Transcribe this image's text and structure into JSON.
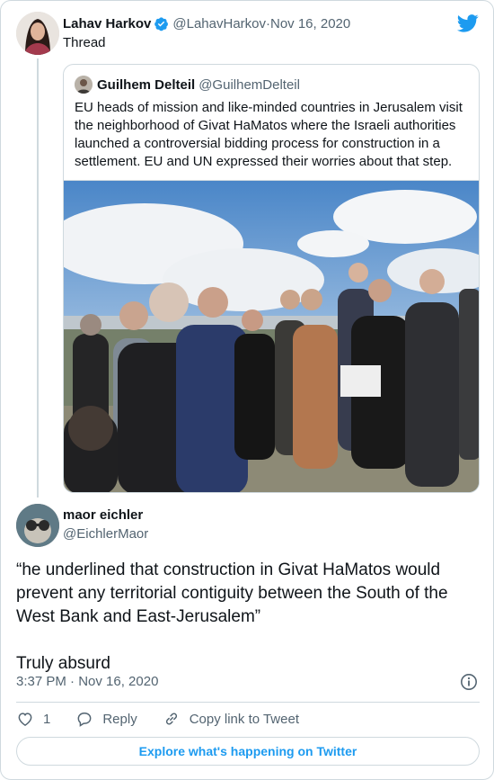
{
  "tweet": {
    "author_name": "Lahav Harkov",
    "author_handle": "@LahavHarkov",
    "separator": " · ",
    "date": "Nov 16, 2020",
    "thread_label": "Thread"
  },
  "quoted": {
    "author_name": "Guilhem Delteil",
    "author_handle": "@GuilhemDelteil",
    "text": "EU heads of mission and like-minded countries in Jerusalem visit the neighborhood of Givat HaMatos where the Israeli authorities launched a controversial bidding process for construction in a settlement. EU and UN expressed their worries about that step."
  },
  "reply": {
    "author_name": "maor eichler",
    "author_handle": "@EichlerMaor",
    "text_line1": "“he underlined that construction in Givat HaMatos would prevent any territorial contiguity between the South of the West Bank and East-Jerusalem”",
    "text_line2": "Truly absurd",
    "timestamp": "3:37 PM · Nov 16, 2020"
  },
  "actions": {
    "like_count": "1",
    "reply_label": "Reply",
    "copy_label": "Copy link to Tweet"
  },
  "explore_label": "Explore what's happening on Twitter",
  "colors": {
    "accent": "#1d9bf0",
    "muted": "#536471",
    "border": "#cfd9de"
  },
  "icons": [
    "verified-badge-icon",
    "twitter-bird-icon",
    "info-icon",
    "heart-icon",
    "reply-bubble-icon",
    "link-icon"
  ]
}
